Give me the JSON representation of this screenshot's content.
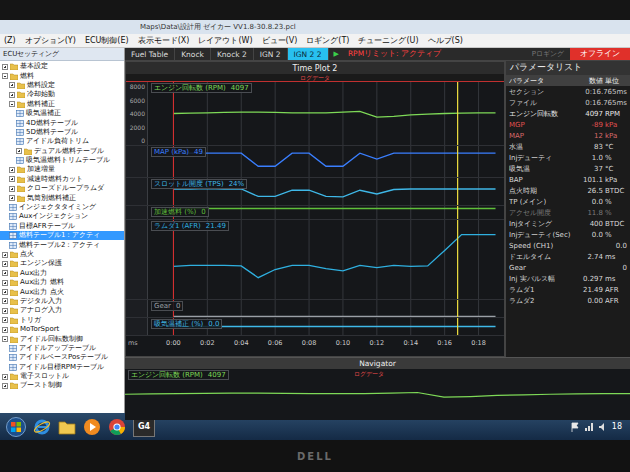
{
  "window": {
    "title": "Maps\\Data\\設計用 ゼイカー VV1.8-30.8.23.pcl"
  },
  "menu": [
    "(Z)",
    "オプション(Y)",
    "ECU制御(E)",
    "表示モード(X)",
    "レイアウト(W)",
    "ビュー(V)",
    "ロギング(T)",
    "チューニング(U)",
    "ヘルプ(S)"
  ],
  "sidebar": {
    "title": "ECUセッティング",
    "items": [
      {
        "label": "基本設定",
        "kind": "folder",
        "expanded": false,
        "selected": false
      },
      {
        "label": "燃料",
        "kind": "folder",
        "expanded": true,
        "selected": false,
        "children": [
          {
            "label": "燃料設定",
            "kind": "folder",
            "expanded": false,
            "selected": false
          },
          {
            "label": "冷却始動",
            "kind": "folder",
            "expanded": false,
            "selected": false
          },
          {
            "label": "燃料補正",
            "kind": "folder",
            "expanded": true,
            "selected": false,
            "children": [
              {
                "label": "吸気温補正",
                "kind": "table",
                "selected": false
              },
              {
                "label": "4D燃料テーブル",
                "kind": "table",
                "selected": false
              },
              {
                "label": "5D燃料テーブル",
                "kind": "table",
                "selected": false
              },
              {
                "label": "アイドル負荷トリム",
                "kind": "table",
                "selected": false
              },
              {
                "label": "デュアル燃料テーブル",
                "kind": "folder",
                "expanded": false,
                "selected": false
              },
              {
                "label": "吸気温燃料トリムテーブル",
                "kind": "table",
                "selected": false
              }
            ]
          },
          {
            "label": "加速増量",
            "kind": "folder",
            "expanded": false,
            "selected": false
          },
          {
            "label": "減速時燃料カット",
            "kind": "folder",
            "expanded": false,
            "selected": false
          },
          {
            "label": "クローズドループラムダ",
            "kind": "folder",
            "expanded": false,
            "selected": false
          },
          {
            "label": "気筒別燃料補正",
            "kind": "folder",
            "expanded": false,
            "selected": false
          },
          {
            "label": "インジェクタタイミング",
            "kind": "table",
            "selected": false
          },
          {
            "label": "Auxインジェクション",
            "kind": "table",
            "selected": false
          },
          {
            "label": "目標AFRテーブル",
            "kind": "table",
            "selected": false
          },
          {
            "label": "燃料テーブル1：アクティ",
            "kind": "table",
            "selected": true
          },
          {
            "label": "燃料テーブル2：アクティ",
            "kind": "table",
            "selected": false
          }
        ]
      },
      {
        "label": "点火",
        "kind": "folder",
        "expanded": false,
        "selected": false
      },
      {
        "label": "エンジン保護",
        "kind": "folder",
        "expanded": false,
        "selected": false
      },
      {
        "label": "Aux出力",
        "kind": "folder",
        "expanded": false,
        "selected": false
      },
      {
        "label": "Aux出力 燃料",
        "kind": "folder",
        "expanded": false,
        "selected": false
      },
      {
        "label": "Aux出力 点火",
        "kind": "folder",
        "expanded": false,
        "selected": false
      },
      {
        "label": "デジタル入力",
        "kind": "folder",
        "expanded": false,
        "selected": false
      },
      {
        "label": "アナログ入力",
        "kind": "folder",
        "expanded": false,
        "selected": false
      },
      {
        "label": "トリガ",
        "kind": "folder",
        "expanded": false,
        "selected": false
      },
      {
        "label": "MoTorSport",
        "kind": "folder",
        "expanded": false,
        "selected": false
      },
      {
        "label": "アイドル回転数制御",
        "kind": "folder",
        "expanded": true,
        "selected": false,
        "children": [
          {
            "label": "アイドルアップテーブル",
            "kind": "table",
            "selected": false
          },
          {
            "label": "アイドルベースPosテーブル",
            "kind": "table",
            "selected": false
          },
          {
            "label": "アイドル目標RPMテーブル",
            "kind": "table",
            "selected": false
          }
        ]
      },
      {
        "label": "電子スロットル",
        "kind": "folder",
        "expanded": false,
        "selected": false
      },
      {
        "label": "ブースト制御",
        "kind": "folder",
        "expanded": false,
        "selected": false
      }
    ]
  },
  "tabs": [
    {
      "label": "Fuel Table",
      "selected": false
    },
    {
      "label": "Knock",
      "selected": false
    },
    {
      "label": "Knock 2",
      "selected": false
    },
    {
      "label": "IGN 2",
      "selected": false
    },
    {
      "label": "IGN 2 2",
      "selected": true
    }
  ],
  "play": "▶",
  "status": {
    "rpm_limit": "RPMリミット: アクティブ",
    "logging": "Pロギング",
    "offline": "オフライン"
  },
  "chart": {
    "title": "Time Plot 2",
    "log_label": "ログデータ",
    "unit": "ms",
    "start_t": 0,
    "cursor_t": 16.765,
    "x_ticks": [
      {
        "label": "0:00",
        "t": 0
      },
      {
        "label": "0:02",
        "t": 2
      },
      {
        "label": "0:04",
        "t": 4
      },
      {
        "label": "0:06",
        "t": 6
      },
      {
        "label": "0:08",
        "t": 8
      },
      {
        "label": "0:10",
        "t": 10
      },
      {
        "label": "0:12",
        "t": 12
      },
      {
        "label": "0:14",
        "t": 14
      },
      {
        "label": "0:16",
        "t": 16
      },
      {
        "label": "0:18",
        "t": 18
      }
    ],
    "tracks": [
      {
        "name": "エンジン回転数 (RPM)",
        "value": "4097",
        "color": "#7ed957",
        "min": 0,
        "max": 8000,
        "ticks": [
          "8000",
          "6000",
          "4000",
          "2000",
          "0"
        ],
        "values": [
          4000,
          4050,
          4100,
          4150,
          4200,
          4200,
          4150,
          4100,
          4100,
          4100,
          4200,
          4300,
          3500,
          3600,
          3800,
          3900,
          4000,
          4050,
          4097,
          4100
        ]
      },
      {
        "name": "MAP (kPa)",
        "value": "49",
        "color": "#3a7fff",
        "min": 0,
        "max": 120,
        "ticks": [],
        "values": [
          95,
          95,
          95,
          95,
          95,
          40,
          40,
          95,
          95,
          40,
          40,
          95,
          70,
          95,
          95,
          95,
          95,
          95,
          95,
          95
        ]
      },
      {
        "name": "スロットル開度 (TPS)",
        "value": "24%",
        "color": "#3fb8e8",
        "min": 0,
        "max": 100,
        "ticks": [],
        "values": [
          60,
          60,
          62,
          60,
          60,
          30,
          30,
          55,
          55,
          30,
          28,
          55,
          40,
          58,
          60,
          60,
          60,
          60,
          60,
          60
        ]
      },
      {
        "name": "加速燃料 (%)",
        "value": "0",
        "color": "#5fbf3a",
        "min": -5,
        "max": 1,
        "ticks": [],
        "values": [
          0,
          0,
          0,
          0,
          0,
          0,
          0,
          0,
          0,
          0,
          0,
          0,
          0,
          0,
          0,
          0,
          0,
          0,
          0,
          0
        ]
      },
      {
        "name": "ラムダ1 (AFR)",
        "value": "21.49",
        "color": "#2fb0e0",
        "min": 8,
        "max": 24,
        "ticks": [],
        "values": [
          14.5,
          14.7,
          14.7,
          14.7,
          14.6,
          12.0,
          13.8,
          14.7,
          14.7,
          14.0,
          13.5,
          14.7,
          14.2,
          14.7,
          14.5,
          14.6,
          18.0,
          21.49,
          21.49,
          21.49
        ]
      },
      {
        "name": "Gear",
        "value": "0",
        "color": "#9aa0a6",
        "min": 0,
        "max": 6,
        "ticks": [],
        "values": [
          0,
          0,
          0,
          0,
          0,
          0,
          0,
          0,
          0,
          0,
          0,
          0,
          0,
          0,
          0,
          0,
          0,
          0,
          0,
          0
        ]
      },
      {
        "name": "吸気温補正 (%)",
        "value": "0.0",
        "color": "#3fb8e8",
        "min": -1,
        "max": 1,
        "ticks": [],
        "values": [
          0,
          0,
          0,
          0,
          0,
          0,
          0,
          0,
          0,
          0,
          0,
          0,
          0,
          0,
          0,
          0,
          0,
          0,
          0,
          0
        ]
      }
    ]
  },
  "parameters": {
    "title": "パラメータリスト",
    "columns": [
      "パラメータ",
      "数値",
      "単位"
    ],
    "rows": [
      {
        "name": "セクション",
        "value": "0:16.765ms",
        "unit": "",
        "color": "#c8c8c8"
      },
      {
        "name": "ファイル",
        "value": "0:16.765ms",
        "unit": "",
        "color": "#c8c8c8"
      },
      {
        "name": "エンジン回転数",
        "value": "4097",
        "unit": "RPM",
        "color": "#e8e8e8"
      },
      {
        "name": "MGP",
        "value": "-89",
        "unit": "kPa",
        "color": "#e05050"
      },
      {
        "name": "MAP",
        "value": "12",
        "unit": "kPa",
        "color": "#d86a6a"
      },
      {
        "name": "水温",
        "value": "83",
        "unit": "°C",
        "color": "#d8d8d8"
      },
      {
        "name": "Injデューティ",
        "value": "1.0",
        "unit": "%",
        "color": "#d8d8d8"
      },
      {
        "name": "吸気温",
        "value": "37",
        "unit": "°C",
        "color": "#d8d8d8"
      },
      {
        "name": "BAP",
        "value": "101.1",
        "unit": "kPa",
        "color": "#d8d8d8"
      },
      {
        "name": "点火時期",
        "value": "26.5",
        "unit": "BTDC",
        "color": "#d8d8d8"
      },
      {
        "name": "TP (メイン)",
        "value": "0.0",
        "unit": "%",
        "color": "#d8d8d8"
      },
      {
        "name": "アクセル開度",
        "value": "11.8",
        "unit": "%",
        "color": "#7a7a7a"
      },
      {
        "name": "Injタイミング",
        "value": "400",
        "unit": "BTDC",
        "color": "#d8d8d8"
      },
      {
        "name": "Injデューティ(Sec)",
        "value": "0.0",
        "unit": "%",
        "color": "#d8d8d8"
      },
      {
        "name": "Speed (CH1)",
        "value": "0.0",
        "unit": "",
        "color": "#d8d8d8"
      },
      {
        "name": "ドエルタイム",
        "value": "2.74",
        "unit": "ms",
        "color": "#d8d8d8"
      },
      {
        "name": "Gear",
        "value": "0",
        "unit": "",
        "color": "#d8d8d8"
      },
      {
        "name": "Inj 実パルス幅",
        "value": "0.297",
        "unit": "ms",
        "color": "#d8d8d8"
      },
      {
        "name": "ラムダ1",
        "value": "21.49",
        "unit": "AFR",
        "color": "#d8d8d8"
      },
      {
        "name": "ラムダ2",
        "value": "0.00",
        "unit": "AFR",
        "color": "#d8d8d8"
      }
    ]
  },
  "navigator": {
    "title": "Navigator",
    "label": "エンジン回転数 (RPM)",
    "value": "4097",
    "log_label": "ログデータ",
    "min": 0,
    "max": 8000,
    "values": [
      4000,
      4050,
      4100,
      4150,
      4200,
      4200,
      4150,
      4100,
      4100,
      4100,
      4200,
      4300,
      3500,
      3600,
      3800,
      3900,
      4000,
      4050,
      4097,
      4100
    ]
  },
  "taskbar": {
    "apps": [
      {
        "kind": "start",
        "label": ""
      },
      {
        "kind": "ie",
        "label": ""
      },
      {
        "kind": "folder",
        "label": ""
      },
      {
        "kind": "media",
        "label": ""
      },
      {
        "kind": "chrome",
        "label": ""
      },
      {
        "kind": "app",
        "label": "G4"
      }
    ],
    "clock": "18"
  },
  "bezel": {
    "brand": "DELL"
  }
}
